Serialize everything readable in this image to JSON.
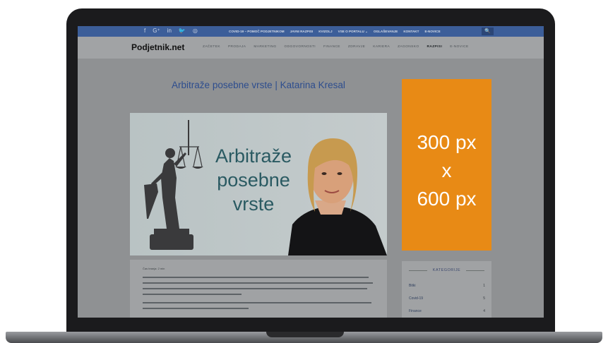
{
  "site": {
    "logo": "Podjetnik.net",
    "topbar": {
      "social_icons": [
        "facebook-icon",
        "google-plus-icon",
        "linkedin-icon",
        "twitter-icon",
        "instagram-icon"
      ],
      "social_glyphs": [
        "f",
        "G⁺",
        "in",
        "🐦",
        "◎"
      ],
      "links": [
        "COVID-19 – POMOČ PODJETNIKOM",
        "JAVNI RAZPISI",
        "KVIZOLJ",
        "VSE O PORTALU ⌄",
        "OGLAŠEVANJE",
        "KONTAKT",
        "E-NOVICE"
      ],
      "search_glyph": "🔍"
    },
    "nav": [
      "ZAČETEK",
      "PRODAJA",
      "MARKETING",
      "ODGOVORNOSTI",
      "FINANCE",
      "ZDRAVJE",
      "KARIERA",
      "ZAGONSKO",
      "RAZPISI",
      "E-NOVICE"
    ],
    "nav_active_index": 8
  },
  "article": {
    "title": "Arbitraže posebne vrste | Katarina Kresal",
    "feature_text": [
      "Arbitraže",
      "posebne",
      "vrste"
    ],
    "meta": "Čas branja: 2 min"
  },
  "ad": {
    "lines": [
      "300 px",
      "x",
      "600 px"
    ],
    "color": "#e88a15"
  },
  "sidebar": {
    "heading": "KATEGORIJE",
    "categories": [
      {
        "label": "Bitki",
        "count": "1"
      },
      {
        "label": "Covid-19",
        "count": "5"
      },
      {
        "label": "Finance",
        "count": "4"
      }
    ]
  },
  "colors": {
    "topbar": "#3c5e99",
    "title": "#2d4d8e",
    "overlay_gray": "#8f9193"
  }
}
